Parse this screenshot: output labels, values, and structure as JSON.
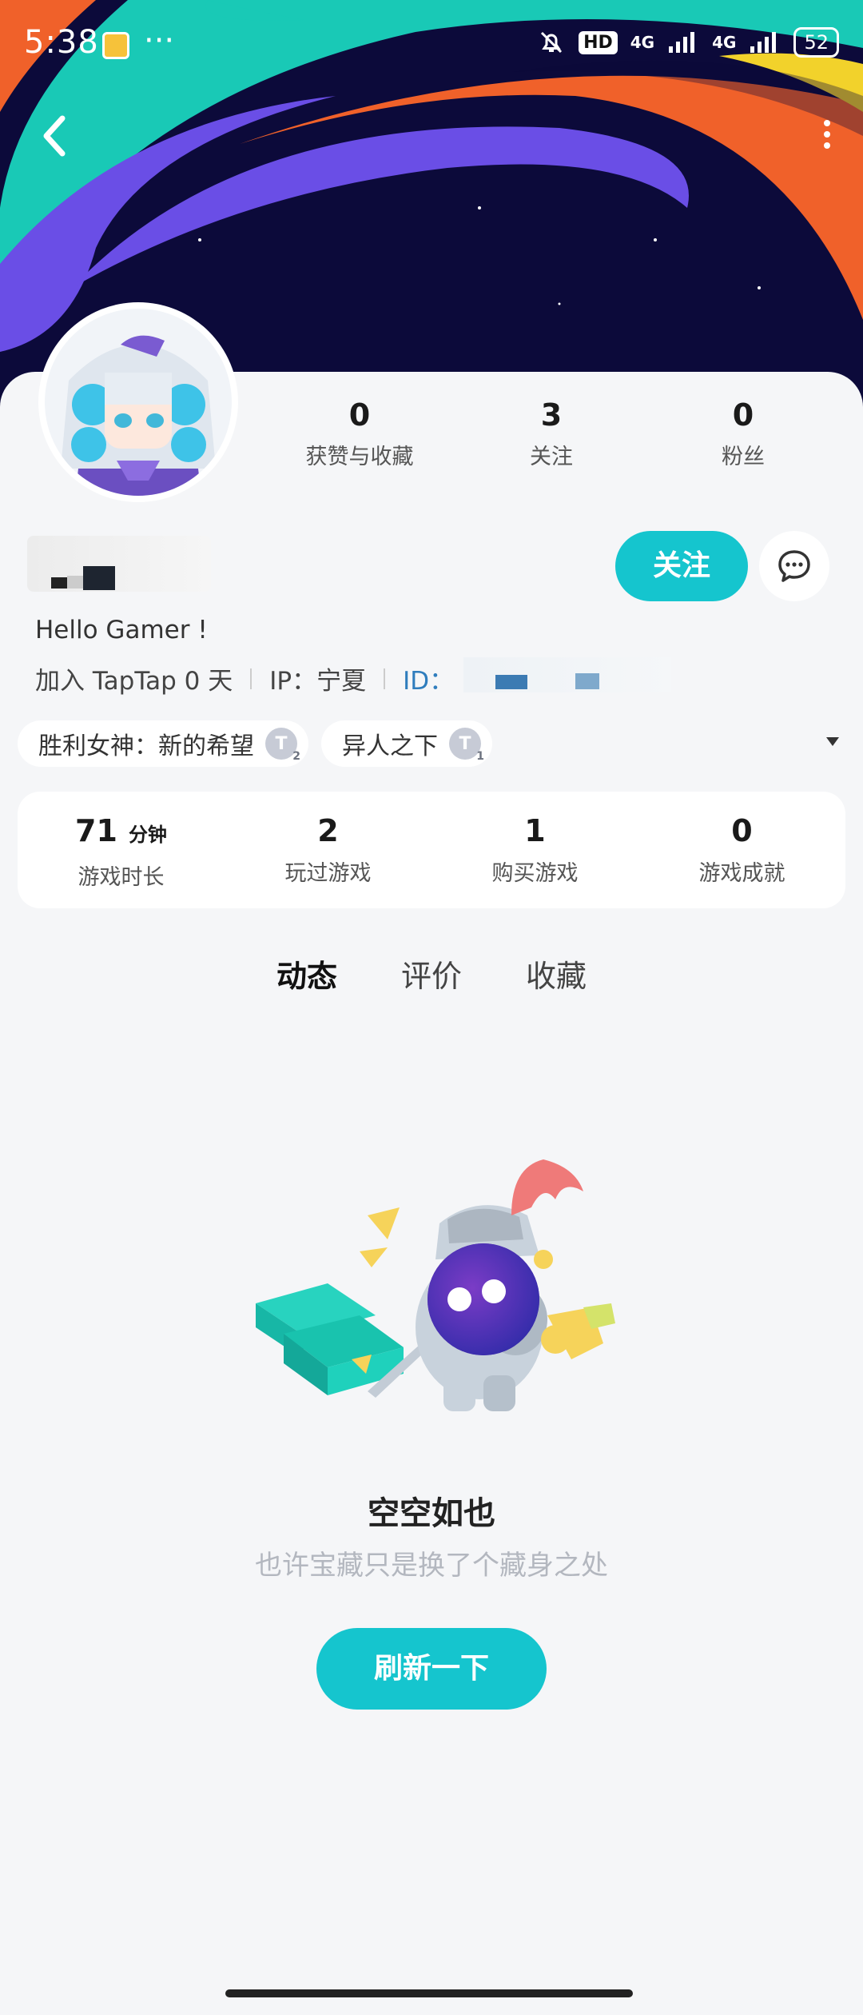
{
  "status_bar": {
    "time": "5:38",
    "dots": "···",
    "hd": "HD",
    "net1": "4G",
    "net2": "4G",
    "battery": "52"
  },
  "nav": {
    "back_icon": "chevron-left-icon",
    "more_icon": "vertical-dots-icon"
  },
  "profile": {
    "stats": [
      {
        "value": "0",
        "label": "获赞与收藏"
      },
      {
        "value": "3",
        "label": "关注"
      },
      {
        "value": "0",
        "label": "粉丝"
      }
    ],
    "follow_label": "关注",
    "bio": "Hello Gamer !",
    "joined": "加入 TapTap 0 天",
    "ip": "IP：宁夏",
    "id_label": "ID：",
    "tags": [
      {
        "label": "胜利女神：新的希望",
        "badge": "T",
        "level": "2"
      },
      {
        "label": "异人之下",
        "badge": "T",
        "level": "1"
      }
    ]
  },
  "game_stats": [
    {
      "value": "71",
      "unit": "分钟",
      "label": "游戏时长"
    },
    {
      "value": "2",
      "unit": "",
      "label": "玩过游戏"
    },
    {
      "value": "1",
      "unit": "",
      "label": "购买游戏"
    },
    {
      "value": "0",
      "unit": "",
      "label": "游戏成就"
    }
  ],
  "tabs": [
    {
      "label": "动态",
      "active": true
    },
    {
      "label": "评价",
      "active": false
    },
    {
      "label": "收藏",
      "active": false
    }
  ],
  "empty": {
    "title": "空空如也",
    "subtitle": "也许宝藏只是换了个藏身之处",
    "refresh_label": "刷新一下"
  },
  "colors": {
    "accent": "#15c5ce",
    "banner_bg": "#0c0a3a",
    "link": "#2f7dbd"
  }
}
